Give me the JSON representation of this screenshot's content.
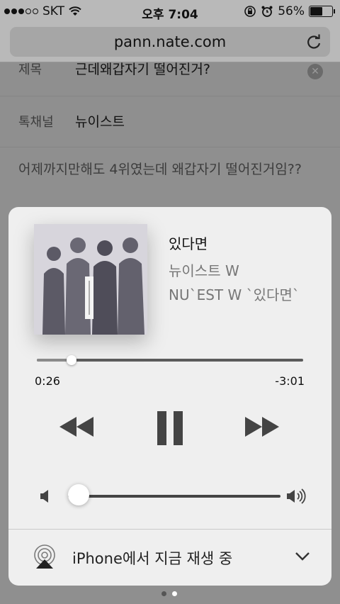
{
  "status_bar": {
    "carrier": "SKT",
    "time": "오후 7:04",
    "battery_text": "56%",
    "battery_level": 0.56
  },
  "browser": {
    "url": "pann.nate.com"
  },
  "page": {
    "title_label": "제목",
    "title_value": "근데왜갑자기 떨어진거?",
    "channel_label": "톡채널",
    "channel_value": "뉴이스트",
    "body_text": "어제까지만해도 4위였는데 왜갑자기 떨어진거임??"
  },
  "now_playing": {
    "song_title": "있다면",
    "artist": "뉴이스트 W",
    "album": "NU`EST W `있다면`",
    "elapsed": "0:26",
    "remaining": "-3:01",
    "progress": 0.13,
    "volume": 0.05,
    "output_device": "iPhone에서 지금 재생 중"
  },
  "icons": {
    "rewind": "rewind-icon",
    "pause": "pause-icon",
    "forward": "fast-forward-icon",
    "airplay": "airplay-icon",
    "reload": "reload-icon"
  },
  "colors": {
    "card_bg": "#efefef",
    "control_dark": "#444444"
  }
}
